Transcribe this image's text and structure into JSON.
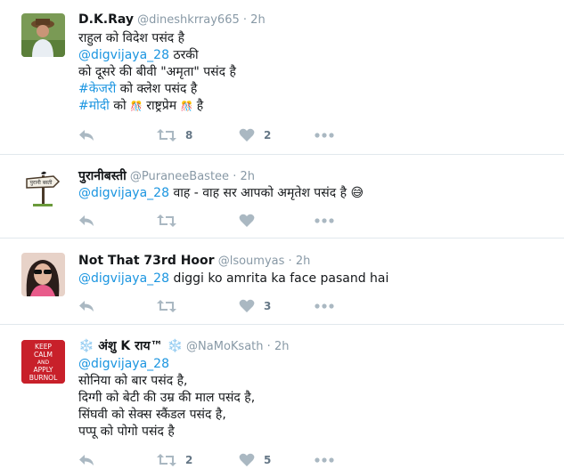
{
  "tweets": [
    {
      "name": "D.K.Ray",
      "handle": "@dineshkrray665",
      "sep": "·",
      "time": "2h",
      "lines": [
        [
          {
            "t": "राहुल को विदेश पसंद है",
            "link": false
          }
        ],
        [
          {
            "t": "@digvijaya_28",
            "link": true
          },
          {
            "t": " ठरकी",
            "link": false
          }
        ],
        [
          {
            "t": " को दूसरे की बीवी \"अमृता\" पसंद है",
            "link": false
          }
        ],
        [
          {
            "t": "#केजरी",
            "link": true
          },
          {
            "t": " को क्लेश पसंद है",
            "link": false
          }
        ],
        [
          {
            "t": "#मोदी",
            "link": true
          },
          {
            "t": " को ",
            "link": false
          },
          {
            "t": "🎊",
            "link": false
          },
          {
            "t": " राष्ट्रप्रेम ",
            "link": false
          },
          {
            "t": "🎊",
            "link": false
          },
          {
            "t": "  है",
            "link": false
          }
        ]
      ],
      "retweets": "8",
      "likes": "2"
    },
    {
      "name": "पुरानीबस्ती",
      "handle": "@PuraneeBastee",
      "sep": "·",
      "time": "2h",
      "lines": [
        [
          {
            "t": "@digvijaya_28",
            "link": true
          },
          {
            "t": " वाह - वाह सर आपको अमृतेश पसंद है 😅",
            "link": false
          }
        ]
      ],
      "retweets": "",
      "likes": ""
    },
    {
      "name": "Not That 73rd Hoor",
      "handle": "@lsoumyas",
      "sep": "·",
      "time": "2h",
      "lines": [
        [
          {
            "t": "@digvijaya_28",
            "link": true
          },
          {
            "t": " diggi ko amrita ka face pasand hai",
            "link": false
          }
        ]
      ],
      "retweets": "",
      "likes": "3"
    },
    {
      "name": "❄️ अंशु K राय™ ❄️",
      "handle": "@NaMoKsath",
      "sep": "·",
      "time": "2h",
      "lines": [
        [
          {
            "t": "@digvijaya_28",
            "link": true
          }
        ],
        [
          {
            "t": "सोनिया को बार पसंद है,",
            "link": false
          }
        ],
        [
          {
            "t": "दिग्गी को बेटी की उम्र की माल पसंद है,",
            "link": false
          }
        ],
        [
          {
            "t": "सिंघवी को सेक्स स्कैंडल पसंद है,",
            "link": false
          }
        ],
        [
          {
            "t": "पप्पू को पोगो पसंद है",
            "link": false
          }
        ]
      ],
      "retweets": "2",
      "likes": "5"
    }
  ],
  "avatar4_text": [
    "KEEP",
    "CALM",
    "AND",
    "APPLY",
    "BURNOL"
  ],
  "avatar2_sign": "पुरानी बस्ती",
  "colors": {
    "link": "#1b95e0",
    "muted": "#8899a6",
    "icon": "#aab8c2",
    "divider": "#e1e8ed"
  },
  "icons": {
    "reply": "reply-icon",
    "retweet": "retweet-icon",
    "like": "heart-icon",
    "more": "more-icon"
  }
}
